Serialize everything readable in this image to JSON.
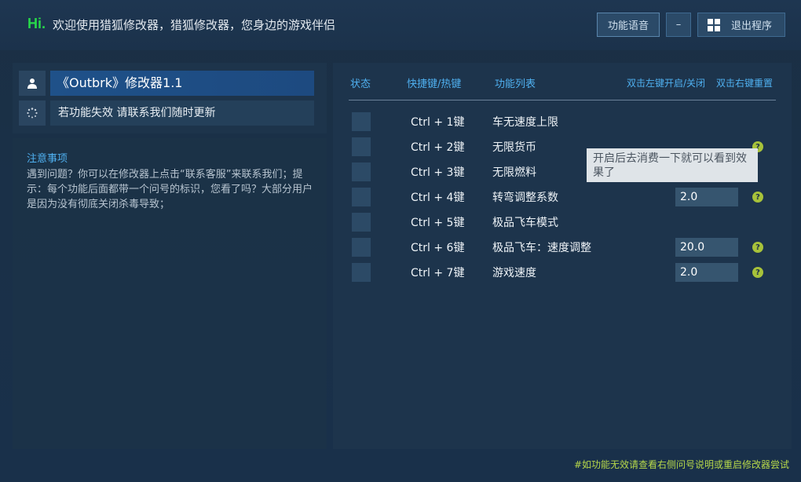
{
  "header": {
    "hi": "Hi.",
    "welcome": "欢迎使用猎狐修改器，猎狐修改器，您身边的游戏伴侣",
    "voice_button": "功能语音",
    "minimize_button": "–",
    "exit_button": "退出程序"
  },
  "left": {
    "title": "《Outbrk》修改器1.1",
    "warning": "若功能失效  请联系我们随时更新",
    "notice_title": "注意事项",
    "notice_text": "遇到问题？你可以在修改器上点击“联系客服”来联系我们；提示：每个功能后面都带一个问号的标识，您看了吗？大部分用户是因为没有彻底关闭杀毒导致；"
  },
  "table": {
    "headers": {
      "status": "状态",
      "hotkey": "快捷键/热键",
      "features": "功能列表",
      "left_click": "双击左键开启/关闭",
      "right_click": "双击右键重置"
    },
    "rows": [
      {
        "hotkey": "Ctrl  +  1键",
        "name": "车无速度上限",
        "value": "",
        "help": false
      },
      {
        "hotkey": "Ctrl  +  2键",
        "name": "无限货币",
        "value": "",
        "help": true
      },
      {
        "hotkey": "Ctrl  +  3键",
        "name": "无限燃料",
        "value": "",
        "help": false
      },
      {
        "hotkey": "Ctrl  +  4键",
        "name": "转弯调整系数",
        "value": "2.0",
        "help": true
      },
      {
        "hotkey": "Ctrl  +  5键",
        "name": "极品飞车模式",
        "value": "",
        "help": false
      },
      {
        "hotkey": "Ctrl  +  6键",
        "name": "极品飞车：速度调整",
        "value": "20.0",
        "help": true
      },
      {
        "hotkey": "Ctrl  +  7键",
        "name": "游戏速度",
        "value": "2.0",
        "help": true
      }
    ],
    "help_glyph": "?"
  },
  "tooltip": "开启后去消费一下就可以看到效果了",
  "footer_note": "#如功能无效请查看右侧问号说明或重启修改器尝试",
  "icons": {
    "user": "user-icon",
    "spinner": "loading-icon",
    "windows": "windows-icon",
    "help": "question-icon"
  },
  "colors": {
    "accent_green": "#27d84a",
    "header_blue": "#4fb0f0",
    "help_green": "#a7c23a",
    "footer_green": "#b7d84a"
  }
}
